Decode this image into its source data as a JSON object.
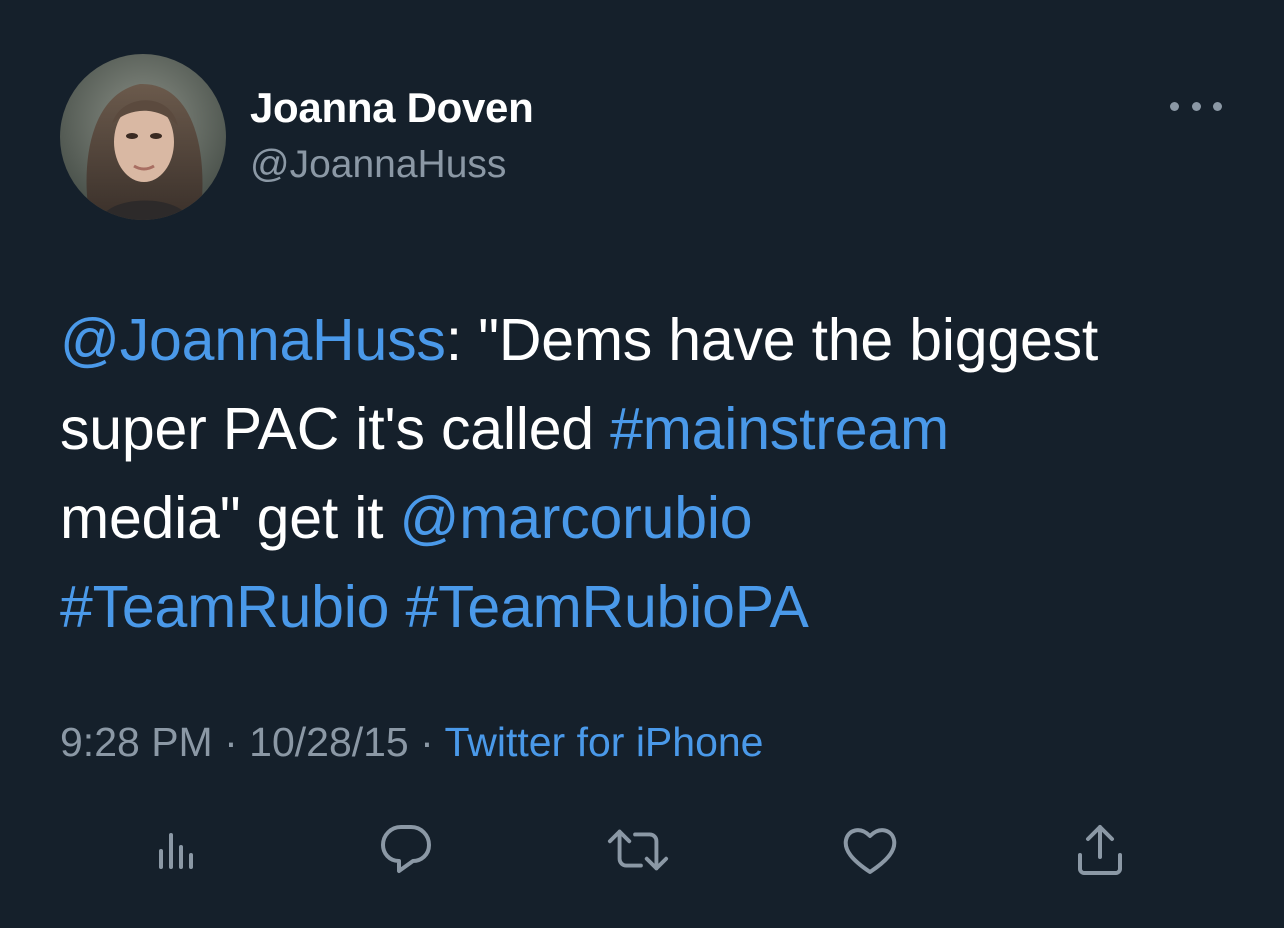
{
  "author": {
    "display_name": "Joanna Doven",
    "handle": "@JoannaHuss"
  },
  "tweet": {
    "line1": {
      "mention": "@JoannaHuss",
      "text": ": \"Dems have the biggest"
    },
    "line2": {
      "text": "super PAC it's called ",
      "hashtag": "#mainstream"
    },
    "line3": {
      "text": "media\" get it ",
      "mention": "@marcorubio"
    },
    "line4": {
      "hashtag1": "#TeamRubio",
      "space": " ",
      "hashtag2": "#TeamRubioPA"
    }
  },
  "meta": {
    "time": "9:28 PM",
    "sep1": " · ",
    "date": "10/28/15",
    "sep2": " · ",
    "source": "Twitter for iPhone"
  },
  "actions": {
    "icons": [
      "analytics-icon",
      "reply-icon",
      "retweet-icon",
      "like-icon",
      "share-icon"
    ]
  },
  "colors": {
    "background": "#15202b",
    "text": "#ffffff",
    "secondary": "#8b98a5",
    "link": "#4a99e9"
  }
}
